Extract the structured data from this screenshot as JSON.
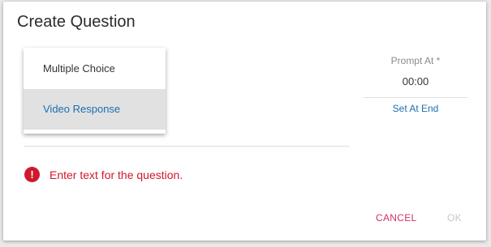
{
  "dialog": {
    "title": "Create Question"
  },
  "menu": {
    "items": [
      {
        "label": "Multiple Choice",
        "selected": false
      },
      {
        "label": "Video Response",
        "selected": true
      }
    ]
  },
  "prompt": {
    "label": "Prompt At *",
    "value": "00:00",
    "set_at_end": "Set At End"
  },
  "error": {
    "icon": "error-exclamation-icon",
    "message": "Enter text for the question."
  },
  "actions": {
    "cancel": "CANCEL",
    "ok": "OK"
  },
  "colors": {
    "accent": "#1a6fb0",
    "error": "#d0182d",
    "cancel": "#d1306b",
    "disabled": "#c7c7c7"
  }
}
